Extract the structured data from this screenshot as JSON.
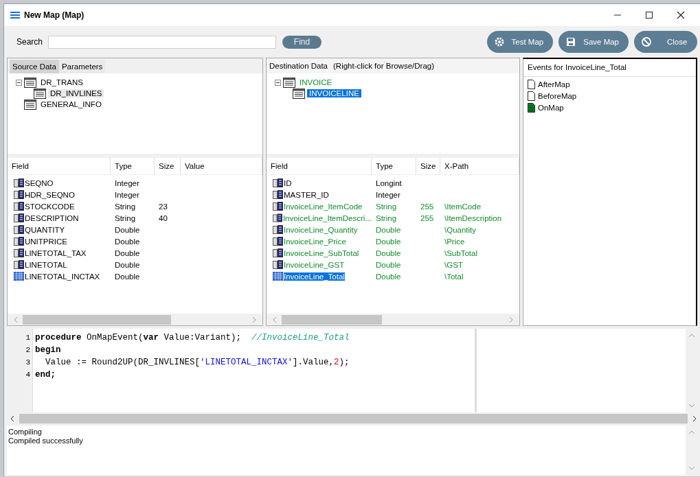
{
  "window": {
    "title": "New Map (Map)"
  },
  "search": {
    "label": "Search",
    "button": "Find"
  },
  "actions": [
    {
      "label": "Test Map",
      "kind": "test"
    },
    {
      "label": "Save Map",
      "kind": "save"
    },
    {
      "label": "Close",
      "kind": "close"
    }
  ],
  "source": {
    "tabs": [
      {
        "label": "Source Data",
        "selected": true
      },
      {
        "label": "Parameters",
        "selected": false
      }
    ],
    "tree": [
      {
        "label": "DR_TRANS",
        "selected": false,
        "expanded": true,
        "children": [
          {
            "label": "DR_INVLINES",
            "selected": true
          }
        ]
      },
      {
        "label": "GENERAL_INFO",
        "selected": false
      }
    ],
    "columns": [
      "Field",
      "Type",
      "Size",
      "Value"
    ],
    "rows": [
      {
        "field": "SEQNO",
        "type": "Integer",
        "size": "",
        "highlighted": false
      },
      {
        "field": "HDR_SEQNO",
        "type": "Integer",
        "size": "",
        "highlighted": false
      },
      {
        "field": "STOCKCODE",
        "type": "String",
        "size": "23",
        "highlighted": false
      },
      {
        "field": "DESCRIPTION",
        "type": "String",
        "size": "40",
        "highlighted": false
      },
      {
        "field": "QUANTITY",
        "type": "Double",
        "size": "",
        "highlighted": false
      },
      {
        "field": "UNITPRICE",
        "type": "Double",
        "size": "",
        "highlighted": false
      },
      {
        "field": "LINETOTAL_TAX",
        "type": "Double",
        "size": "",
        "highlighted": false
      },
      {
        "field": "LINETOTAL",
        "type": "Double",
        "size": "",
        "highlighted": false
      },
      {
        "field": "LINETOTAL_INCTAX",
        "type": "Double",
        "size": "",
        "highlighted": true
      }
    ]
  },
  "destination": {
    "heading": "Destination Data",
    "hint": "(Right-click for Browse/Drag)",
    "tree": [
      {
        "label": "INVOICE",
        "selected": false,
        "mapped": true,
        "expanded": true,
        "children": [
          {
            "label": "INVOICELINE",
            "selected": true
          }
        ]
      }
    ],
    "columns": [
      "Field",
      "Type",
      "Size",
      "X-Path"
    ],
    "rows": [
      {
        "field": "ID",
        "type": "Longint",
        "size": "",
        "xpath": "",
        "mapped": false,
        "selected": false
      },
      {
        "field": "MASTER_ID",
        "type": "Integer",
        "size": "",
        "xpath": "",
        "mapped": false,
        "selected": false
      },
      {
        "field": "InvoiceLine_ItemCode",
        "type": "String",
        "size": "255",
        "xpath": "\\ItemCode",
        "mapped": true,
        "selected": false
      },
      {
        "field": "InvoiceLine_ItemDescri...",
        "type": "String",
        "size": "255",
        "xpath": "\\ItemDescription",
        "mapped": true,
        "selected": false
      },
      {
        "field": "InvoiceLine_Quantity",
        "type": "Double",
        "size": "",
        "xpath": "\\Quantity",
        "mapped": true,
        "selected": false
      },
      {
        "field": "InvoiceLine_Price",
        "type": "Double",
        "size": "",
        "xpath": "\\Price",
        "mapped": true,
        "selected": false
      },
      {
        "field": "InvoiceLine_SubTotal",
        "type": "Double",
        "size": "",
        "xpath": "\\SubTotal",
        "mapped": true,
        "selected": false
      },
      {
        "field": "InvoiceLine_GST",
        "type": "Double",
        "size": "",
        "xpath": "\\GST",
        "mapped": true,
        "selected": false
      },
      {
        "field": "InvoiceLine_Total",
        "type": "Double",
        "size": "",
        "xpath": "\\Total",
        "mapped": true,
        "selected": true
      }
    ]
  },
  "events": {
    "heading": "Events for InvoiceLine_Total",
    "items": [
      {
        "label": "AfterMap",
        "defined": false
      },
      {
        "label": "BeforeMap",
        "defined": false
      },
      {
        "label": "OnMap",
        "defined": true
      }
    ]
  },
  "code": [
    {
      "number": "1",
      "tokens": [
        {
          "text": "procedure",
          "kind": "keyword"
        },
        {
          "text": " OnMapEvent(",
          "kind": "plain"
        },
        {
          "text": "var",
          "kind": "keyword"
        },
        {
          "text": " Value:Variant);  ",
          "kind": "plain"
        },
        {
          "text": "//InvoiceLine_Total",
          "kind": "comment"
        }
      ]
    },
    {
      "number": "2",
      "tokens": [
        {
          "text": "begin",
          "kind": "keyword"
        }
      ]
    },
    {
      "number": "3",
      "tokens": [
        {
          "text": "  Value := Round2UP(DR_INVLINES[",
          "kind": "plain"
        },
        {
          "text": "'LINETOTAL_INCTAX'",
          "kind": "string"
        },
        {
          "text": "].Value,",
          "kind": "plain"
        },
        {
          "text": "2",
          "kind": "number"
        },
        {
          "text": ");",
          "kind": "plain"
        }
      ]
    },
    {
      "number": "4",
      "tokens": [
        {
          "text": "end;",
          "kind": "keyword"
        }
      ]
    }
  ],
  "messages": [
    "Compiling",
    "Compiled successfully"
  ]
}
